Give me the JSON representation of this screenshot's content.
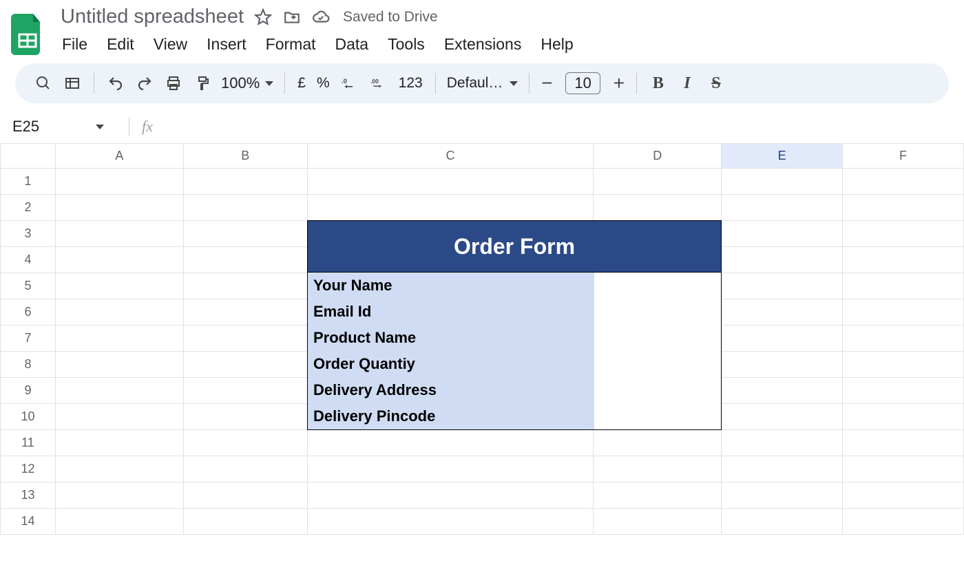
{
  "doc": {
    "title": "Untitled spreadsheet",
    "saved_status": "Saved to Drive"
  },
  "menubar": {
    "items": [
      "File",
      "Edit",
      "View",
      "Insert",
      "Format",
      "Data",
      "Tools",
      "Extensions",
      "Help"
    ]
  },
  "toolbar": {
    "zoom": "100%",
    "currency": "£",
    "percent": "%",
    "num123": "123",
    "font_name": "Defaul…",
    "font_size": "10"
  },
  "namebox": {
    "ref": "E25"
  },
  "formula": {
    "value": ""
  },
  "columns": [
    "A",
    "B",
    "C",
    "D",
    "E",
    "F"
  ],
  "active_column": "E",
  "rows_visible": 14,
  "form": {
    "title": "Order Form",
    "fields": [
      "Your Name",
      "Email Id",
      "Product Name",
      "Order Quantiy",
      "Delivery Address",
      "Delivery Pincode"
    ]
  }
}
